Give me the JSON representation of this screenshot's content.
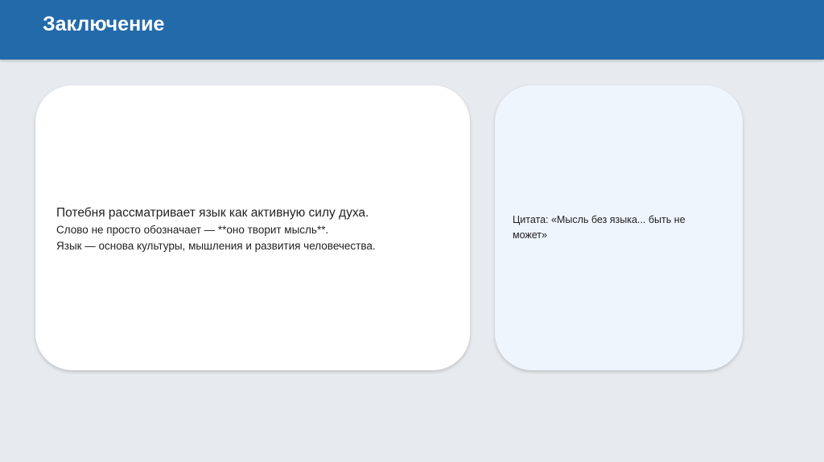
{
  "header": {
    "title": "Заключение",
    "background_color": "#236aaa"
  },
  "main_card": {
    "line1": "Потебня рассматривает язык как активную силу духа.",
    "line2": "Слово не просто обозначает — **оно творит мысль**.",
    "line3": "Язык — основа культуры, мышления и развития человечества."
  },
  "quote_card": {
    "text": "Цитата: «Мысль без языка... быть не может»",
    "background_color": "#eef5fd"
  }
}
